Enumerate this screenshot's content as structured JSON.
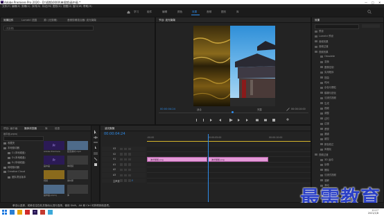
{
  "app": {
    "title": "Adobe Premiere Pro 2020 - D:\\视频\\0000\\单视频\\画中画 *",
    "window_controls": [
      "—",
      "□",
      "✕"
    ]
  },
  "menu": [
    "文件(F)",
    "编辑(E)",
    "剪辑(C)",
    "序列(S)",
    "标记(M)",
    "图形(G)",
    "视图(V)",
    "窗口(W)",
    "帮助(H)"
  ],
  "workspaces": [
    {
      "label": "学习",
      "active": false
    },
    {
      "label": "组件",
      "active": false
    },
    {
      "label": "编辑",
      "active": false
    },
    {
      "label": "颜色",
      "active": false
    },
    {
      "label": "效果",
      "active": true
    },
    {
      "label": "音频",
      "active": false
    },
    {
      "label": "图形",
      "active": false
    },
    {
      "label": "库",
      "active": false
    }
  ],
  "source_panel": {
    "tabs": [
      "效果控件",
      "Lumetri 范围",
      "源: (无剪辑)",
      "音频剪辑混合器: 波光粼粼"
    ],
    "clip_label": "(无剪辑)"
  },
  "program": {
    "tab": "节目: 波光粼粼",
    "timecode": "00:00:04:24",
    "fit": "适合",
    "quality": "完整",
    "duration": "00:00:10:00"
  },
  "effects": {
    "tab": "效果",
    "tree": [
      "预设",
      "Lumetri 预设",
      "音频效果",
      "音频过渡",
      "视频效果",
      "Obsolete",
      "变换",
      "图像控制",
      "实用程序",
      "扭曲",
      "时间",
      "杂色与颗粒",
      "模糊与锐化",
      "沉浸式视频",
      "生成",
      "视频",
      "调整",
      "过时",
      "过渡",
      "透视",
      "通道",
      "键控",
      "颜色校正",
      "风格化",
      "视频过渡",
      "3D 运动",
      "划像",
      "擦除",
      "沉浸式视频",
      "溶解",
      "滑动",
      "缩放",
      "页面剥落"
    ]
  },
  "project": {
    "tabs": [
      "项目: 画中画",
      "媒体浏览器",
      "库",
      "信息"
    ],
    "path": "画中画.prproj",
    "search_placeholder": "",
    "folders": [
      "收藏夹",
      "本地驱动器",
      "C:(本地磁盘)",
      "D:(本地磁盘)",
      "E:(本地磁盘)",
      "网络驱动器",
      "Creative Cloud",
      "团队项目版本"
    ],
    "items": [
      {
        "name": "Adobe Premiere",
        "type": "pr"
      },
      {
        "name": "配置素材.mp4",
        "type": "video"
      },
      {
        "name": "画中画",
        "type": "pr"
      },
      {
        "name": "单视频",
        "type": "folder"
      },
      {
        "name": "视频",
        "type": "video"
      },
      {
        "name": "素材库",
        "type": "folder"
      },
      {
        "name": "画中画.prproj",
        "type": "video"
      },
      {
        "name": "库",
        "type": "folder"
      }
    ]
  },
  "timeline": {
    "tab": "波光粼粼",
    "timecode": "00:00:04:24",
    "ruler": [
      ":00:00",
      "00:00:05:00",
      "00:00:10:00"
    ],
    "tracks": [
      "V3",
      "V2",
      "V1",
      "A1",
      "A2",
      "A3",
      "主声道"
    ],
    "master_value": "0.0",
    "clips": [
      {
        "label": "波光粼粼.png",
        "track": "V1"
      },
      {
        "label": "波光粼粼.png",
        "track": "V1"
      }
    ]
  },
  "status": "单击以选择，或单击空白处并拖动以进行选择。使用 Shift、Alt 和 Ctrl 可获得其他选项。",
  "taskbar": {
    "time": "11:17",
    "date": "2021/1/8"
  },
  "watermark": "最需教育"
}
